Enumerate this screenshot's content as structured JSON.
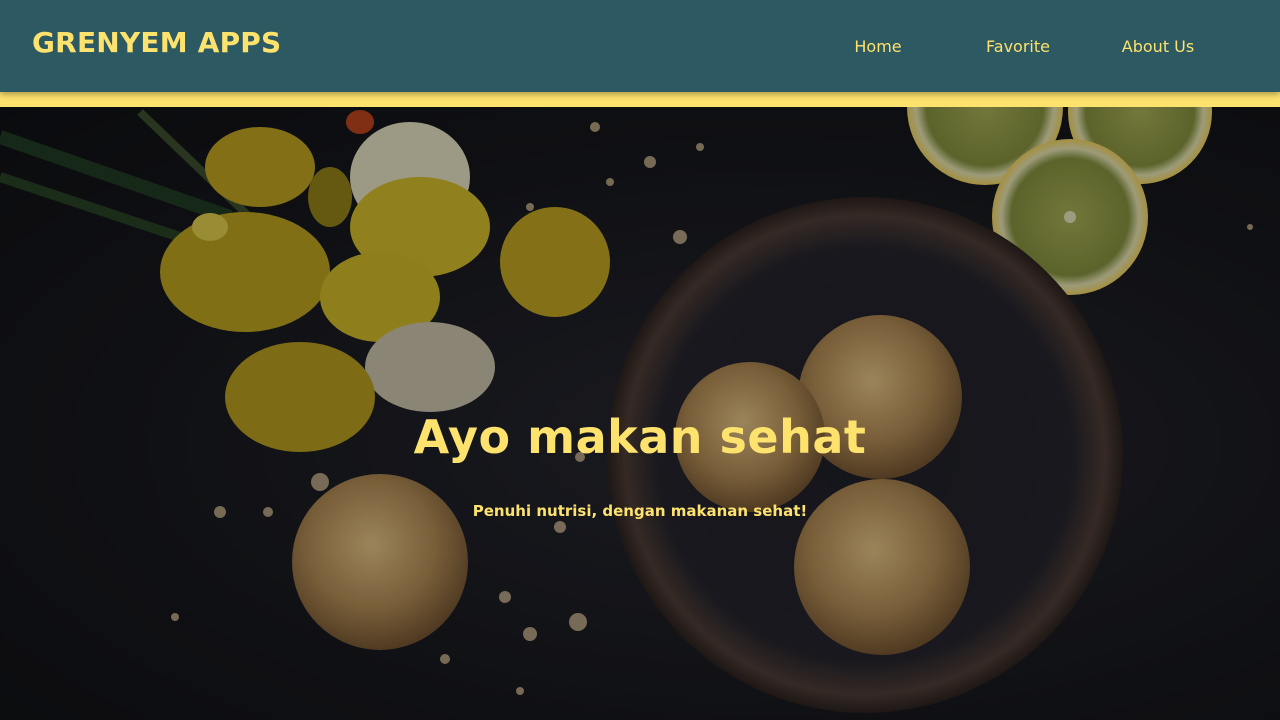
{
  "navbar": {
    "brand": "GRENYEM APPS",
    "links": [
      {
        "label": "Home"
      },
      {
        "label": "Favorite"
      },
      {
        "label": "About Us"
      }
    ]
  },
  "hero": {
    "title": "Ayo makan sehat",
    "subtitle": "Penuhi nutrisi, dengan makanan sehat!"
  },
  "colors": {
    "navbar_bg": "#2c5962",
    "accent": "#fde26d",
    "hero_bg": "#17181d"
  }
}
